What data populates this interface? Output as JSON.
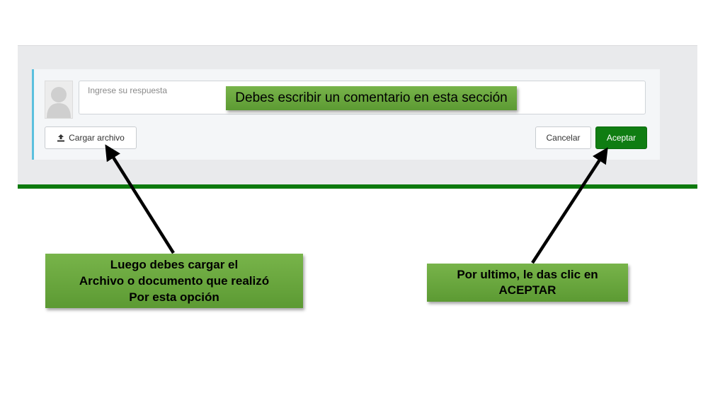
{
  "comment_form": {
    "reply_placeholder": "Ingrese su respuesta",
    "upload_label": "Cargar archivo",
    "cancel_label": "Cancelar",
    "accept_label": "Aceptar"
  },
  "annotations": {
    "comment_hint": "Debes escribir un comentario en esta sección",
    "upload_hint_lines": [
      "Luego debes cargar el",
      "Archivo o documento que realizó",
      "Por esta opción"
    ],
    "accept_hint_lines": [
      "Por ultimo, le das clic en",
      "ACEPTAR"
    ]
  },
  "colors": {
    "accept_button": "#0f7d12",
    "callout_green": "#6aa63e",
    "card_accent": "#5bc0de",
    "panel_rule": "#0d7a0d"
  },
  "icons": [
    "avatar-placeholder-icon",
    "upload-icon"
  ]
}
